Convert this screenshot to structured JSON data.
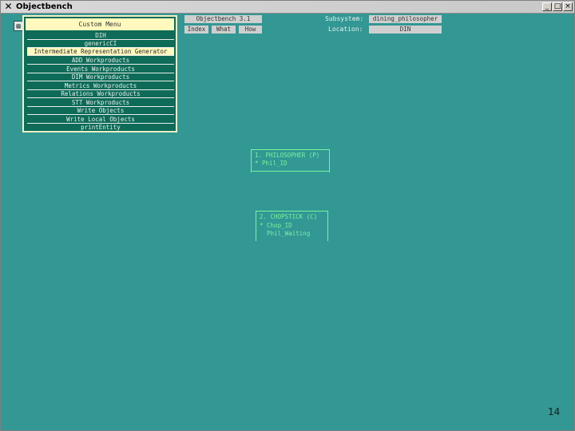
{
  "window": {
    "title": "Objectbench",
    "controls": [
      "_",
      "□",
      "×"
    ]
  },
  "menu": {
    "title": "Custom Menu",
    "items": [
      "DIH",
      "genericCI",
      "Intermediate Representation Generator",
      "ADD Workproducts",
      "Events Workproducts",
      "DIM Workproducts",
      "Metrics Workproducts",
      "Relations Workproducts",
      "STT Workproducts",
      "Write Objects",
      "Write Local Objects",
      "printEntity"
    ],
    "highlighted_index": 2
  },
  "toolbar": {
    "version": "Objectbench 3.1",
    "index_label": "Index",
    "what_label": "What",
    "how_label": "How",
    "subsystem_label": "Subsystem:",
    "subsystem_value": "dining_philosopher",
    "location_label": "Location:",
    "location_value": "DIN"
  },
  "objects": [
    {
      "header": "1. PHILOSOPHER (P)",
      "lines": [
        "* Phil_ID"
      ]
    },
    {
      "header": "2. CHOPSTICK (C)",
      "lines": [
        "* Chop_ID",
        "  Phil_Waiting"
      ]
    }
  ],
  "page_number": "14",
  "colors": {
    "background": "#339794",
    "menu": "#0d6b58",
    "highlight": "#fff9bd",
    "object_text": "#7cf29b"
  }
}
